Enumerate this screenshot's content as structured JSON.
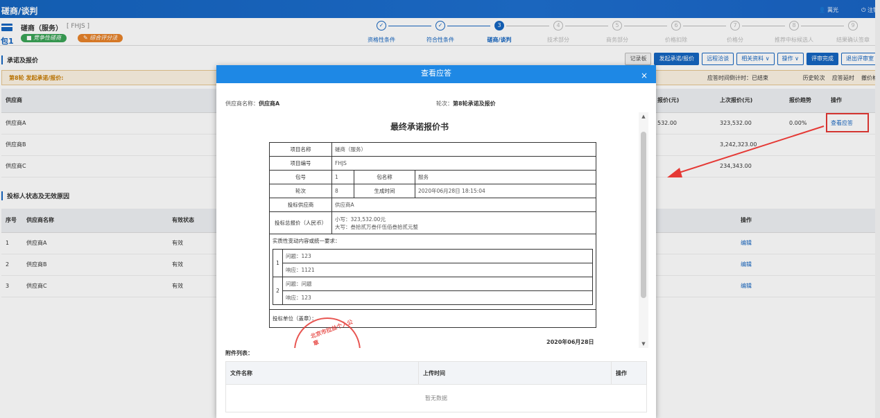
{
  "header": {
    "title": "磋商/谈判",
    "user": "蒿光",
    "logout": "注销"
  },
  "package": {
    "num": "包1",
    "name": "磋商（服务）",
    "code": "[ FHJS ]",
    "tag_green": "竞争性磋商",
    "tag_orange": "综合评分法"
  },
  "steps": [
    {
      "sym": "✓",
      "label": "资格性条件",
      "state": "done"
    },
    {
      "sym": "✓",
      "label": "符合性条件",
      "state": "done"
    },
    {
      "sym": "3",
      "label": "磋商/谈判",
      "state": "active"
    },
    {
      "sym": "4",
      "label": "技术部分",
      "state": "todo"
    },
    {
      "sym": "5",
      "label": "商务部分",
      "state": "todo"
    },
    {
      "sym": "6",
      "label": "价格扣除",
      "state": "todo"
    },
    {
      "sym": "7",
      "label": "价格分",
      "state": "todo"
    },
    {
      "sym": "8",
      "label": "推荐中标候选人",
      "state": "todo"
    },
    {
      "sym": "9",
      "label": "结果确认签章",
      "state": "todo"
    }
  ],
  "section1": {
    "title": "承诺及报价",
    "buttons": [
      "记录板",
      "发起承诺/报价",
      "远程洽谈",
      "相关资料 ∨",
      "操作 ∨",
      "评审完成",
      "退出评审室"
    ]
  },
  "round": {
    "label": "第8轮 发起承诺/报价:",
    "countdown": "应答时间倒计时：已结束",
    "links": [
      "历史轮次",
      "应答延时",
      "撤价格"
    ]
  },
  "supplier_table": {
    "headers": [
      "供应商",
      "报价(元)",
      "上次报价(元)",
      "报价趋势",
      "操作"
    ],
    "rows": [
      {
        "name": "供应商A",
        "price": "532.00",
        "last": "323,532.00",
        "trend": "0.00%",
        "op": "查看应答"
      },
      {
        "name": "供应商B",
        "price": "",
        "last": "3,242,323.00",
        "trend": "",
        "op": ""
      },
      {
        "name": "供应商C",
        "price": "",
        "last": "234,343.00",
        "trend": "",
        "op": ""
      }
    ]
  },
  "section2": {
    "title": "投标人状态及无效原因"
  },
  "status_table": {
    "headers": [
      "序号",
      "供应商名称",
      "有效状态",
      "操作"
    ],
    "rows": [
      {
        "idx": "1",
        "name": "供应商A",
        "state": "有效",
        "op": "编辑"
      },
      {
        "idx": "2",
        "name": "供应商B",
        "state": "有效",
        "op": "编辑"
      },
      {
        "idx": "3",
        "name": "供应商C",
        "state": "有效",
        "op": "编辑"
      }
    ]
  },
  "modal": {
    "title": "查看应答",
    "close": "×",
    "supplier_label": "供应商名称：",
    "supplier_value": "供应商A",
    "round_label": "轮次：",
    "round_value": "第8轮承诺及报价",
    "doc_title": "最终承诺报价书",
    "project_name_k": "项目名称",
    "project_name_v": "磋商（服务）",
    "project_code_k": "项目编号",
    "project_code_v": "FHJS",
    "pkg_k": "包号",
    "pkg_v": "1",
    "pkgname_k": "包名称",
    "pkgname_v": "服务",
    "round_k": "轮次",
    "round_v": "8",
    "gen_k": "生成时间",
    "gen_v": "2020年06月28日 18:15:04",
    "bidder_k": "投标供应商",
    "bidder_v": "供应商A",
    "total_k": "投标总报价（人民币）",
    "total_small": "小写：323,532.00元",
    "total_big": "大写：叁拾贰万叁仟伍佰叁拾贰元整",
    "req_title": "实质性变动内容或统一要求：",
    "qa": [
      {
        "n": "1",
        "q": "问题：123",
        "a": "响应：1121"
      },
      {
        "n": "2",
        "q": "问题：问题",
        "a": "响应：123"
      }
    ],
    "seal_label": "投标单位（盖章）：",
    "stamp_text": "北京市拉丝个人公章",
    "date": "2020年06月28日",
    "attach_title": "附件列表：",
    "attach_headers": [
      "文件名称",
      "上传时间",
      "操作"
    ],
    "attach_empty": "暂无数据"
  }
}
